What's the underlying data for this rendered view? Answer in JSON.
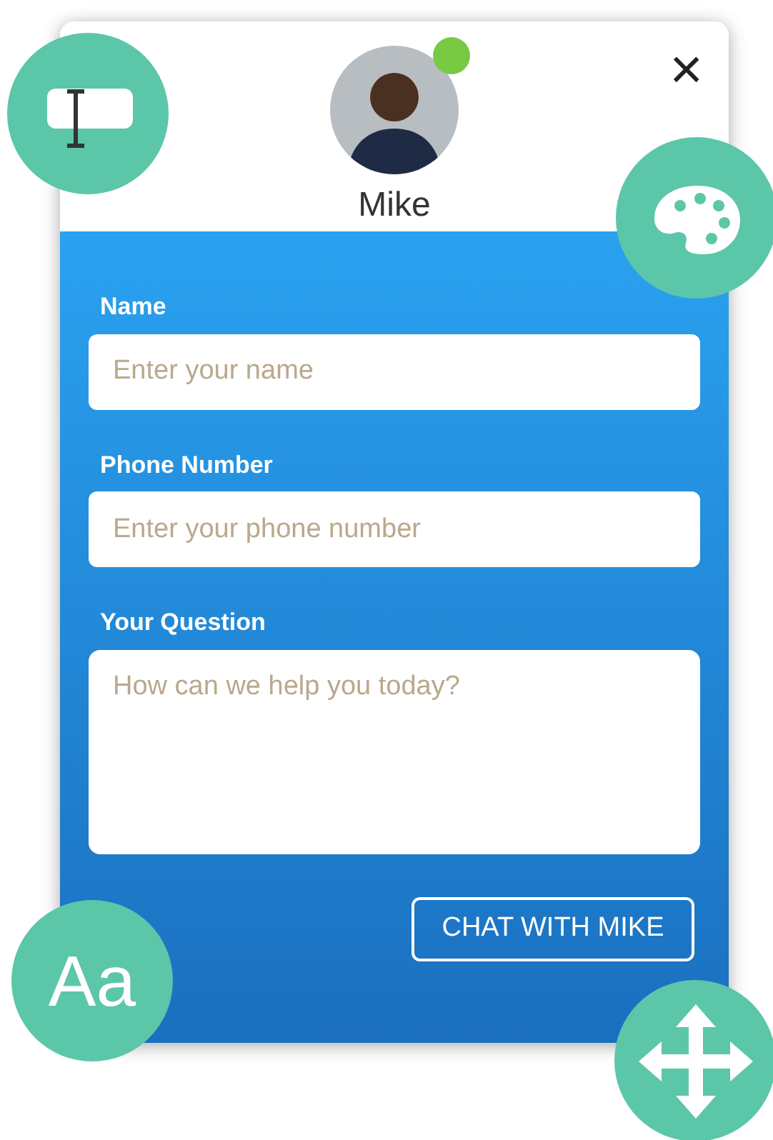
{
  "agent": {
    "name": "Mike",
    "online": true
  },
  "close": {
    "symbol": "×"
  },
  "fields": [
    {
      "kind": "input",
      "label": "Name",
      "placeholder": "Enter your name"
    },
    {
      "kind": "input",
      "label": "Phone Number",
      "placeholder": "Enter your phone number"
    },
    {
      "kind": "textarea",
      "label": "Your Question",
      "placeholder": "How can we help you today?"
    }
  ],
  "submit": {
    "label": "CHAT WITH MIKE"
  },
  "tools": [
    {
      "kind": "text-field"
    },
    {
      "kind": "palette"
    },
    {
      "kind": "font",
      "label": "Aa"
    },
    {
      "kind": "move"
    }
  ]
}
